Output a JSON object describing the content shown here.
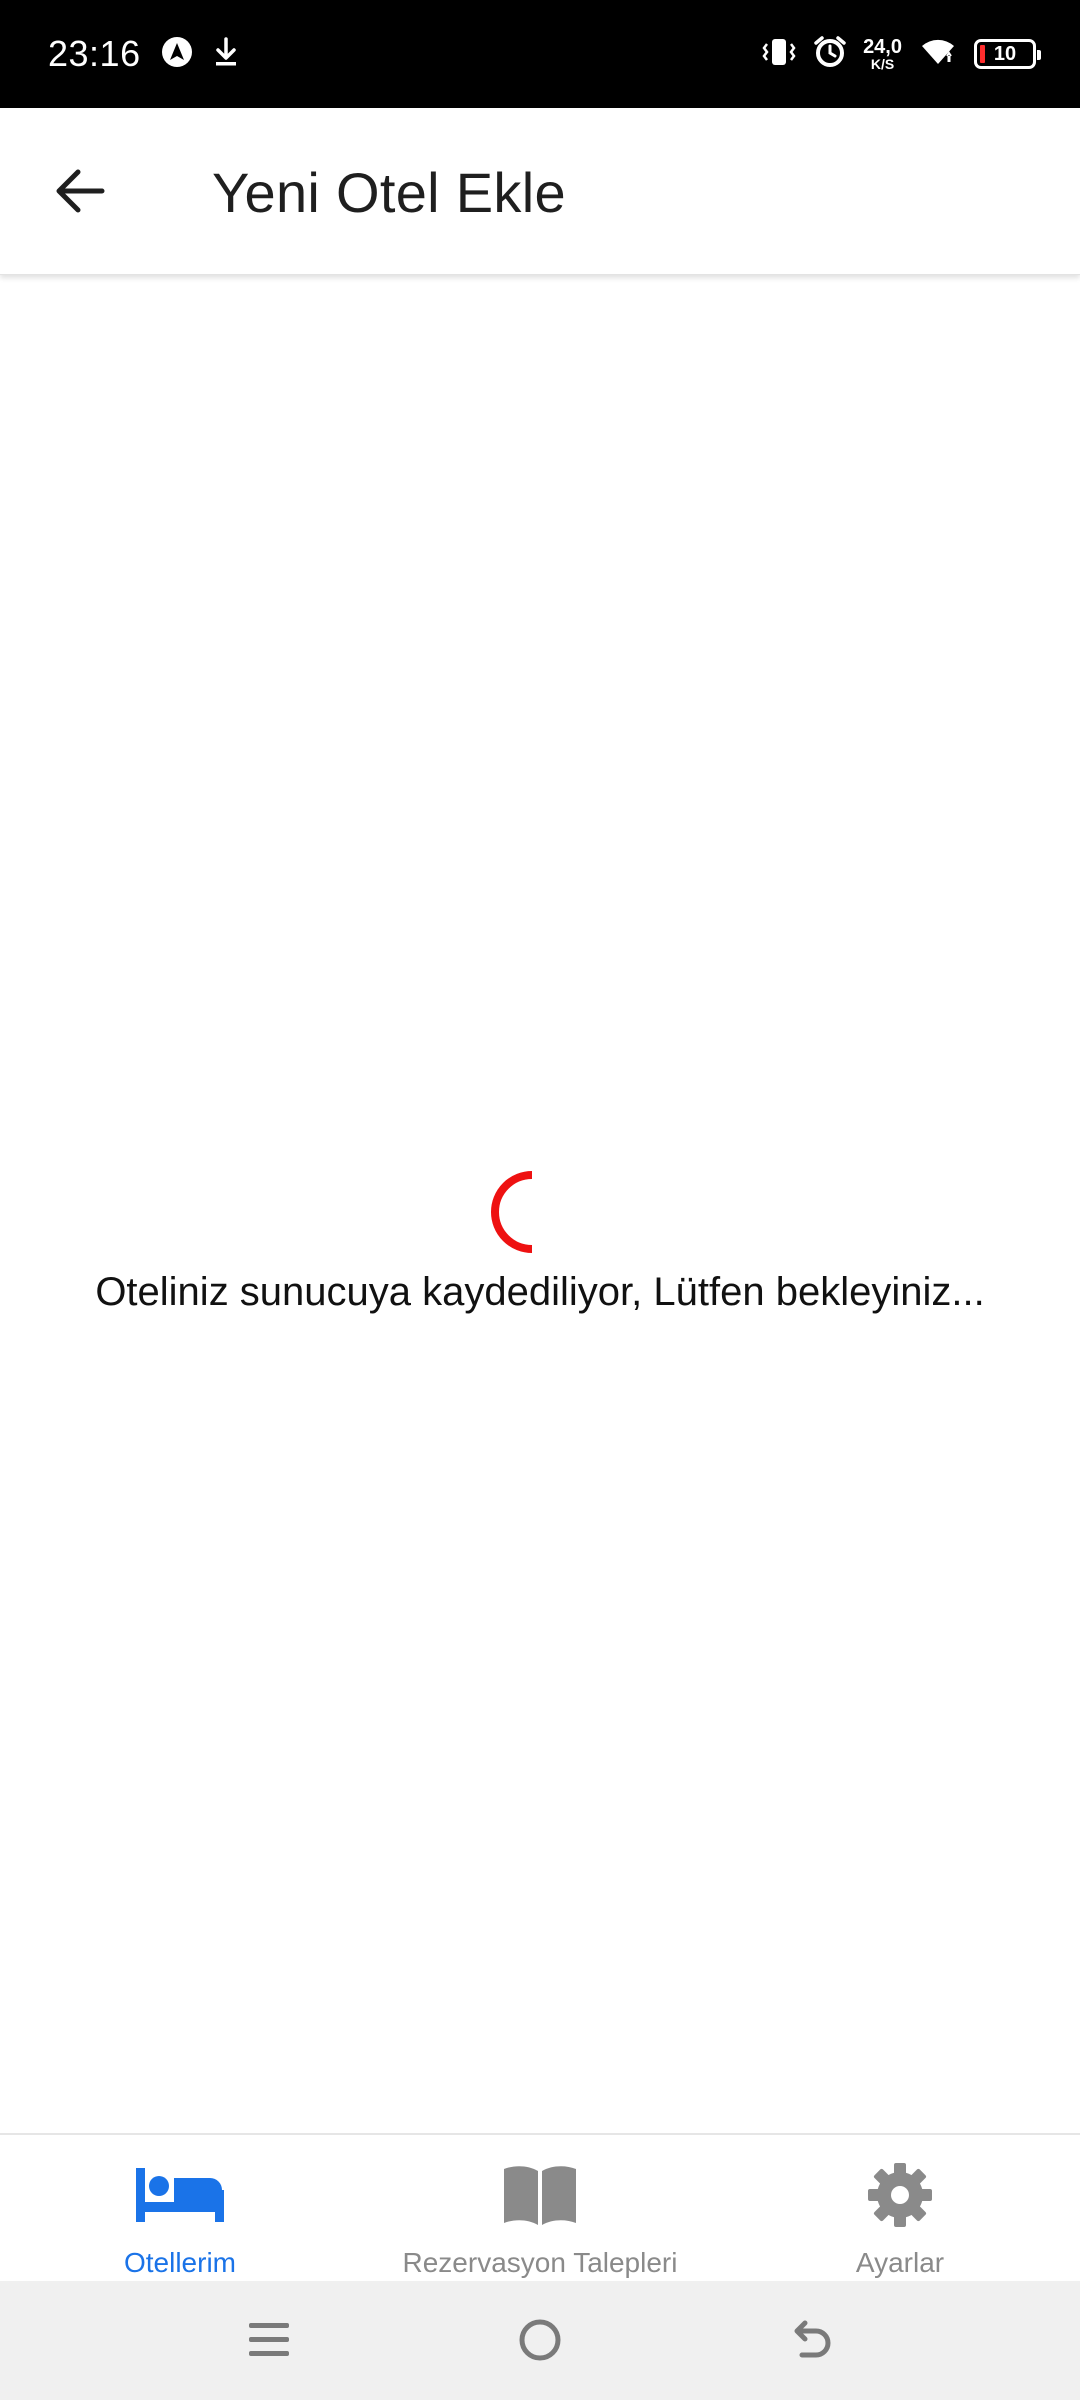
{
  "status_bar": {
    "time": "23:16",
    "net_speed_value": "24,0",
    "net_speed_unit": "K/S",
    "battery_level": "10",
    "icons": [
      "navigation-app-icon",
      "download-icon",
      "vibrate-icon",
      "alarm-icon",
      "wifi-icon",
      "battery-icon"
    ]
  },
  "app_bar": {
    "title": "Yeni Otel Ekle",
    "back_icon": "arrow-left-icon"
  },
  "loading": {
    "message": "Oteliniz sunucuya kaydediliyor, Lütfen bekleyiniz...",
    "spinner_color": "#ee1111"
  },
  "bottom_nav": {
    "items": [
      {
        "label": "Otellerim",
        "icon": "bed-icon",
        "active": true
      },
      {
        "label": "Rezervasyon Talepleri",
        "icon": "book-icon",
        "active": false
      },
      {
        "label": "Ayarlar",
        "icon": "gear-icon",
        "active": false
      }
    ],
    "active_color": "#1a73e8",
    "inactive_color": "#8a8a8a"
  },
  "system_nav": {
    "buttons": [
      "menu-icon",
      "home-icon",
      "back-icon"
    ]
  }
}
